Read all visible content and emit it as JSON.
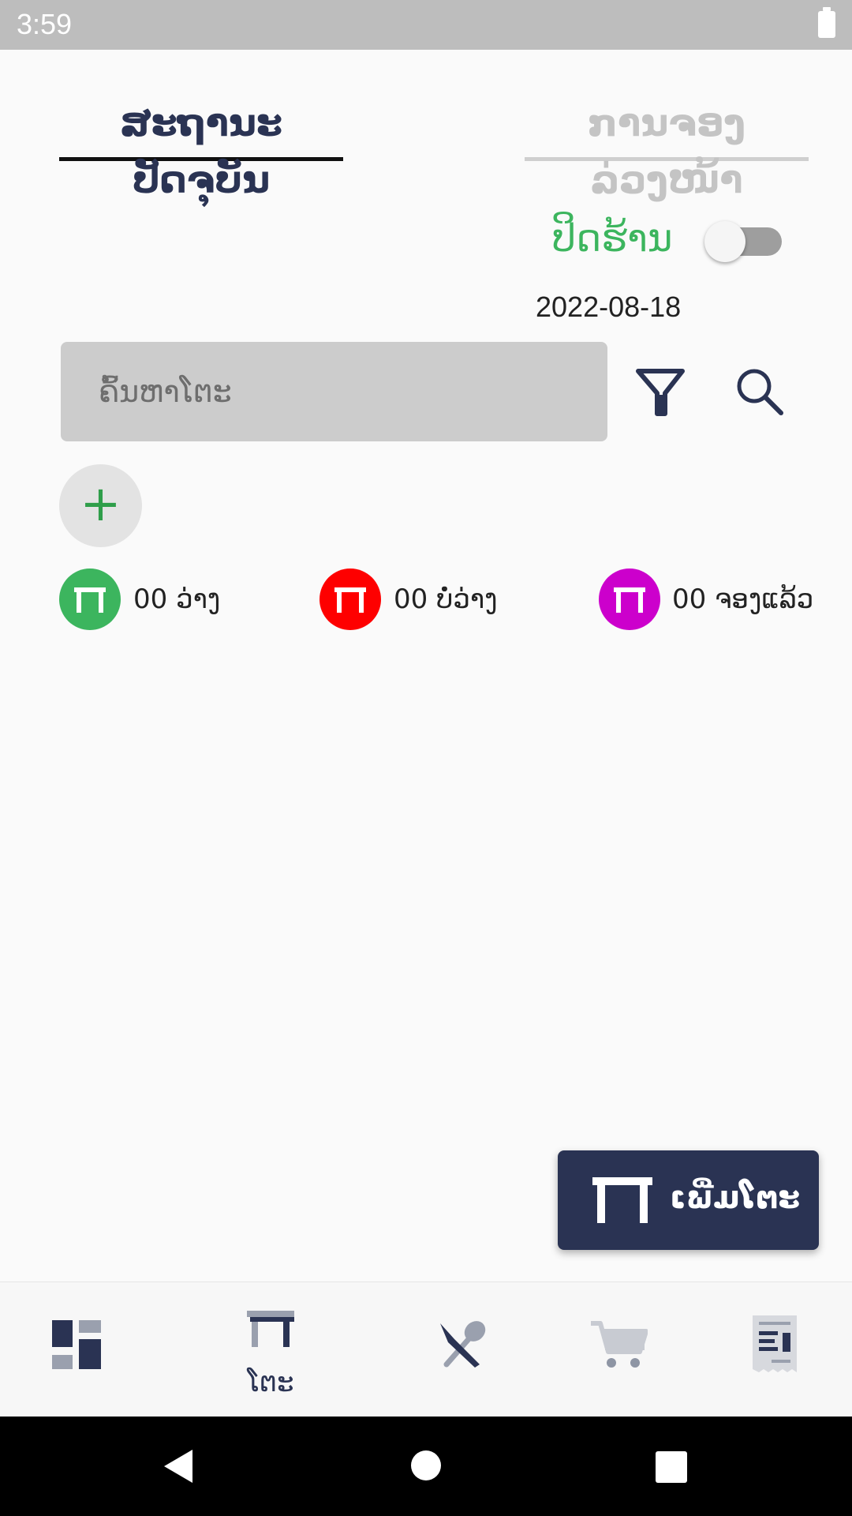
{
  "status_bar": {
    "time": "3:59"
  },
  "tabs": {
    "current": "ສະຖານະປັດຈຸບັນ",
    "advance": "ການຈອງລ່ວງໜ້າ"
  },
  "store": {
    "toggle_label": "ປິດຮ້ານ",
    "toggle_on": false
  },
  "date": "2022-08-18",
  "search": {
    "placeholder": "ຄົ້ນຫາໂຕະ"
  },
  "add_button": {
    "label": "+"
  },
  "legend": [
    {
      "count": "00",
      "label": "ວ່າງ",
      "color": "#3cb55e"
    },
    {
      "count": "00",
      "label": "ບໍ່ວ່າງ",
      "color": "#fe0000"
    },
    {
      "count": "00",
      "label": "ຈອງແລ້ວ",
      "color": "#cc00cc"
    }
  ],
  "fab": {
    "label": "ເພີ່ມໂຕະ"
  },
  "bottom_nav": [
    {
      "icon": "dashboard-icon",
      "label": ""
    },
    {
      "icon": "table-icon",
      "label": "ໂຕະ",
      "active": true
    },
    {
      "icon": "utensils-icon",
      "label": ""
    },
    {
      "icon": "cart-icon",
      "label": ""
    },
    {
      "icon": "receipt-icon",
      "label": ""
    }
  ],
  "colors": {
    "primary": "#2a3353",
    "accent_green": "#3cb55e",
    "search_bg": "#cccccc"
  }
}
